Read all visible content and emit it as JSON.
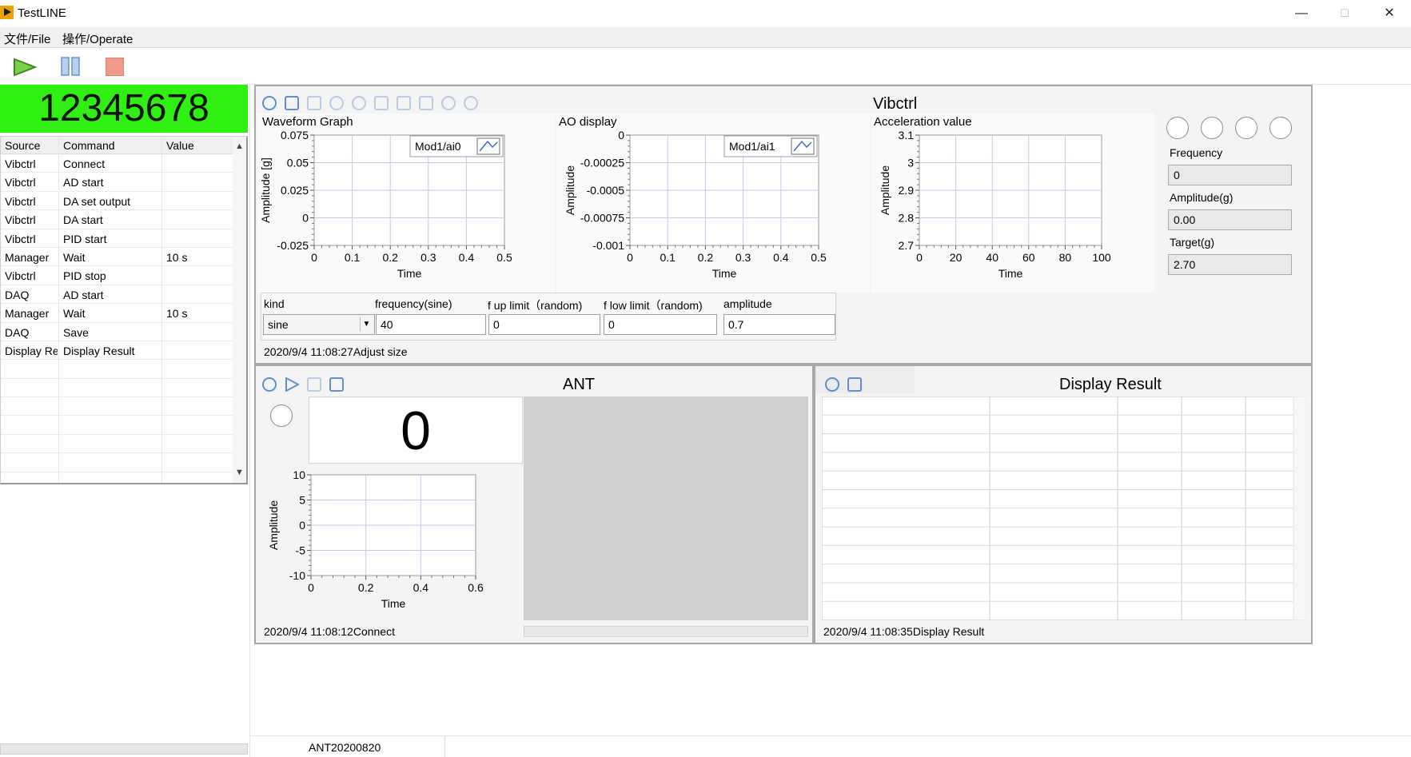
{
  "window": {
    "title": "TestLINE",
    "minimize": "—",
    "maximize": "☐",
    "close": "✕"
  },
  "menu": {
    "file": "文件/File",
    "operate": "操作/Operate"
  },
  "toolbar": {
    "run": "run-icon",
    "pause": "pause-icon",
    "stop": "stop-icon"
  },
  "counter": "12345678",
  "command_table": {
    "headers": [
      "Source",
      "Command",
      "Value"
    ],
    "rows": [
      [
        "Vibctrl",
        "Connect",
        ""
      ],
      [
        "Vibctrl",
        "AD start",
        ""
      ],
      [
        "Vibctrl",
        "DA set output",
        ""
      ],
      [
        "Vibctrl",
        "DA start",
        ""
      ],
      [
        "Vibctrl",
        "PID start",
        ""
      ],
      [
        "Manager",
        "Wait",
        "10 s"
      ],
      [
        "Vibctrl",
        "PID stop",
        ""
      ],
      [
        "DAQ",
        "AD start",
        ""
      ],
      [
        "Manager",
        "Wait",
        "10 s"
      ],
      [
        "DAQ",
        "Save",
        ""
      ],
      [
        "Display Re",
        "Display Result",
        ""
      ],
      [
        "",
        "",
        ""
      ],
      [
        "",
        "",
        ""
      ],
      [
        "",
        "",
        ""
      ],
      [
        "",
        "",
        ""
      ],
      [
        "",
        "",
        ""
      ],
      [
        "",
        "",
        ""
      ]
    ]
  },
  "vibctrl": {
    "title": "Vibctrl",
    "waveform": {
      "title": "Waveform Graph",
      "legend": "Mod1/ai0",
      "ylabel": "Amplitude [g]",
      "xlabel": "Time",
      "yticks": [
        "0.075",
        "0.05",
        "0.025",
        "0",
        "-0.025"
      ],
      "xticks": [
        "0",
        "0.1",
        "0.2",
        "0.3",
        "0.4",
        "0.5"
      ]
    },
    "ao": {
      "title": "AO display",
      "legend": "Mod1/ai1",
      "ylabel": "Amplitude",
      "xlabel": "Time",
      "yticks": [
        "0",
        "-0.00025",
        "-0.0005",
        "-0.00075",
        "-0.001"
      ],
      "xticks": [
        "0",
        "0.1",
        "0.2",
        "0.3",
        "0.4",
        "0.5"
      ]
    },
    "accel": {
      "title": "Acceleration value",
      "ylabel": "Amplitude",
      "xlabel": "Time",
      "yticks": [
        "3.1",
        "3",
        "2.9",
        "2.8",
        "2.7"
      ],
      "xticks": [
        "0",
        "20",
        "40",
        "60",
        "80",
        "100"
      ]
    },
    "frequency_label": "Frequency",
    "frequency_value": "0",
    "amplitude_label": "Amplitude(g)",
    "amplitude_value": "0.00",
    "target_label": "Target(g)",
    "target_value": "2.70",
    "params": {
      "kind_label": "kind",
      "kind_value": "sine",
      "freq_label": "frequency(sine)",
      "freq_value": "40",
      "fup_label": "f up limit（random)",
      "fup_value": "0",
      "flow_label": "f low limit（random)",
      "flow_value": "0",
      "amp_label": "amplitude",
      "amp_value": "0.7"
    },
    "status": "2020/9/4  11:08:27Adjust size"
  },
  "ant": {
    "title": "ANT",
    "big_value": "0",
    "graph": {
      "ylabel": "Amplitude",
      "xlabel": "Time",
      "yticks": [
        "10",
        "5",
        "0",
        "-5",
        "-10"
      ],
      "xticks": [
        "0",
        "0.2",
        "0.4",
        "0.6"
      ]
    },
    "status": "2020/9/4  11:08:12Connect"
  },
  "display_result": {
    "title": "Display Result",
    "status": "2020/9/4  11:08:35Display Result"
  },
  "bottom_status": "ANT20200820",
  "colors": {
    "counter_bg": "#2fef13",
    "icon_blue": "#5f8fd0",
    "grid": "#b9c6e8"
  }
}
